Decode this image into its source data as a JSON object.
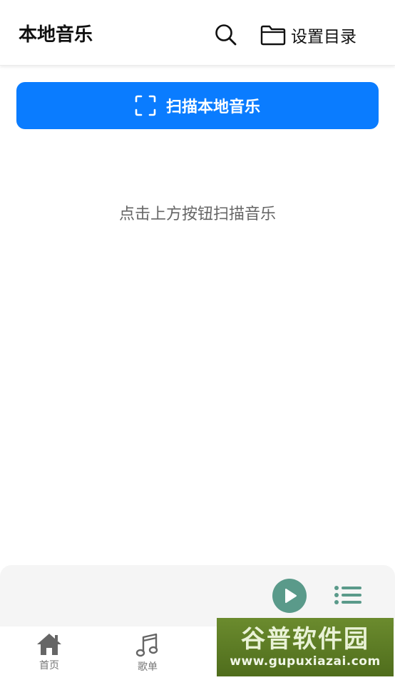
{
  "header": {
    "title": "本地音乐",
    "set_directory_label": "设置目录"
  },
  "scan": {
    "button_label": "扫描本地音乐"
  },
  "empty_state": {
    "hint": "点击上方按钮扫描音乐"
  },
  "tabs": [
    {
      "label": "首页",
      "icon": "home-icon"
    },
    {
      "label": "歌单",
      "icon": "music-note-icon"
    }
  ],
  "watermark": {
    "title": "谷普软件园",
    "url": "www.gupuxiazai.com"
  },
  "colors": {
    "accent": "#0a7cff",
    "play": "#5a9a8a",
    "player_bg": "#f5f5f5"
  }
}
